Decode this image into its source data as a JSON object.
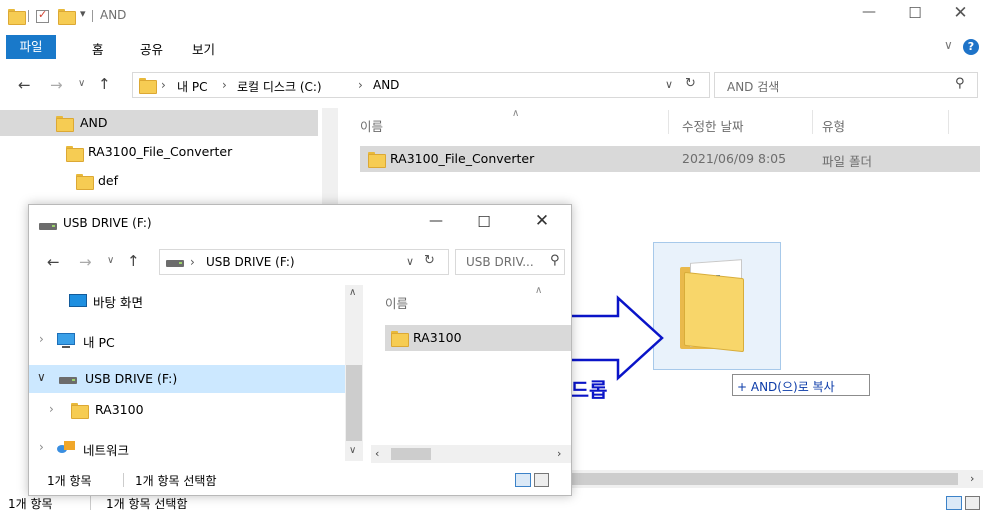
{
  "main_window": {
    "title": "AND",
    "tabs": [
      {
        "label": "파일"
      },
      {
        "label": "홈"
      },
      {
        "label": "공유"
      },
      {
        "label": "보기"
      }
    ],
    "address": {
      "segments": [
        "내 PC",
        "로컬 디스크 (C:)",
        "AND"
      ],
      "search_placeholder": "AND 검색"
    },
    "nav_tree": [
      {
        "label": "AND"
      },
      {
        "label": "RA3100_File_Converter"
      },
      {
        "label": "def"
      }
    ],
    "columns": [
      "이름",
      "수정한 날짜",
      "유형"
    ],
    "rows": [
      {
        "name": "RA3100_File_Converter",
        "date": "2021/06/09 8:05",
        "type": "파일 폴더"
      }
    ],
    "status": {
      "count": "1개 항목",
      "selected": "1개 항목 선택함"
    }
  },
  "usb_window": {
    "title": "USB DRIVE (F:)",
    "address": {
      "segments": [
        "USB DRIVE (F:)"
      ],
      "search_placeholder": "USB DRIV..."
    },
    "nav_tree": [
      {
        "label": "바탕 화면",
        "icon": "desktop-icon"
      },
      {
        "label": "내 PC",
        "icon": "pc-icon"
      },
      {
        "label": "USB DRIVE (F:)",
        "icon": "usb-drive-icon"
      },
      {
        "label": "RA3100",
        "icon": "folder-icon"
      },
      {
        "label": "네트워크",
        "icon": "network-icon"
      }
    ],
    "columns": [
      "이름"
    ],
    "rows": [
      {
        "name": "RA3100"
      }
    ],
    "status": {
      "count": "1개 항목",
      "selected": "1개 항목 선택함"
    }
  },
  "annotation": {
    "drag_drop_label": "드래그 & 드롭",
    "copy_tooltip": "+ AND(으)로 복사",
    "accent_color": "#0a14c8"
  }
}
